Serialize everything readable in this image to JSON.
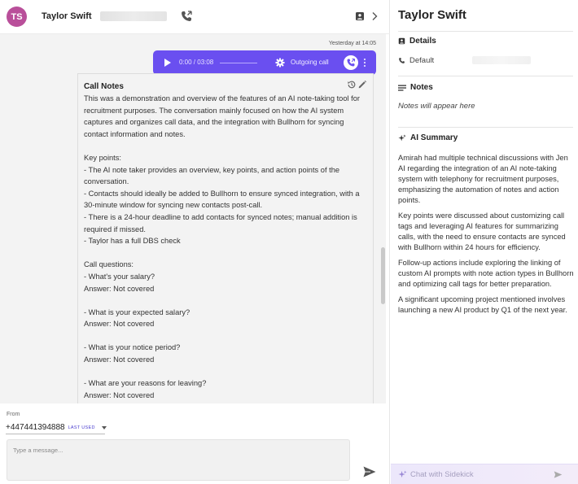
{
  "contact": {
    "initials": "TS",
    "name": "Taylor Swift"
  },
  "conversation": {
    "timestamp": "Yesterday at 14:05",
    "call": {
      "time": "0:00 / 03:08",
      "progress": 0,
      "direction_label": "Outgoing call"
    },
    "notes": {
      "title": "Call Notes",
      "body": "This was a demonstration and overview of the features of an AI note-taking tool for recruitment purposes. The conversation mainly focused on how the AI system captures and organizes call data, and the integration with Bullhorn for syncing contact information and notes.\n\nKey points:\n- The AI note taker provides an overview, key points, and action points of the conversation.\n- Contacts should ideally be added to Bullhorn to ensure synced integration, with a 30-minute window for syncing new contacts post-call.\n- There is a 24-hour deadline to add contacts for synced notes; manual addition is required if missed.\n- Taylor has a full DBS check\n\nCall questions:\n- What's your salary?\nAnswer: Not covered\n\n- What is your expected salary?\nAnswer: Not covered\n\n- What is your notice period?\nAnswer: Not covered\n\n- What are your reasons for leaving?\nAnswer: Not covered"
    }
  },
  "composer": {
    "from_label": "From",
    "from_number": "+447441394888",
    "last_used_badge": "LAST USED",
    "message_placeholder": "Type a message..."
  },
  "sidebar": {
    "title": "Taylor Swift",
    "details_heading": "Details",
    "default_label": "Default",
    "notes_heading": "Notes",
    "notes_placeholder": "Notes will appear here",
    "ai_summary_heading": "AI Summary",
    "ai_summary": [
      "Amirah had multiple technical discussions with Jen AI regarding the integration of an AI note-taking system with telephony for recruitment purposes, emphasizing the automation of notes and action points.",
      "Key points were discussed about customizing call tags and leveraging AI features for summarizing calls, with the need to ensure contacts are synced with Bullhorn within 24 hours for efficiency.",
      "Follow-up actions include exploring the linking of custom AI prompts with note action types in Bullhorn and optimizing call tags for better preparation.",
      "A significant upcoming project mentioned involves launching a new AI product by Q1 of the next year."
    ],
    "sidekick_placeholder": "Chat with Sidekick"
  },
  "colors": {
    "accent": "#6a4ff0",
    "avatar": "#b94f9a",
    "badge": "#4a3dcf"
  },
  "icons": [
    "call-icon",
    "contact-card-icon",
    "chevron-right-icon",
    "play-icon",
    "gear-icon",
    "phone-icon",
    "more-vertical-icon",
    "history-icon",
    "edit-icon",
    "dropdown-icon",
    "send-icon",
    "details-icon",
    "phone-small-icon",
    "notes-icon",
    "sparkle-icon"
  ]
}
